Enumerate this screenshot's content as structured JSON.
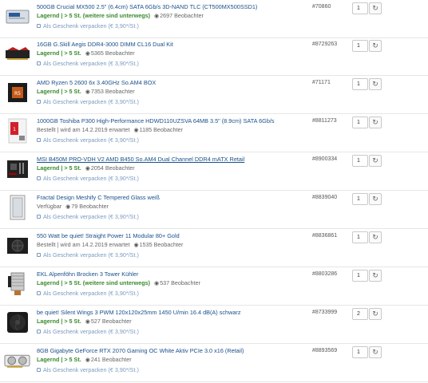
{
  "gift_label": "Als Geschenk verpacken (€ 3,90*/St.)",
  "colors": {
    "link": "#1a4f8a",
    "stock": "#3a8a2e",
    "gift": "#7a9ac0"
  },
  "items": [
    {
      "title": "500GB Crucial MX500 2.5\" (6.4cm) SATA 6Gb/s 3D-NAND TLC (CT500MX500SSD1)",
      "availability": "Lagernd | > 5 St. (weitere sind unterwegs)",
      "availability_type": "stock",
      "watchers": "2697 Beobachter",
      "article_no": "#70860",
      "quantity": "1",
      "thumb_icon": "ssd-icon"
    },
    {
      "title": "16GB G.Skill Aegis DDR4-3000 DIMM CL16 Dual Kit",
      "availability": "Lagernd | > 5 St.",
      "availability_type": "stock",
      "watchers": "5365 Beobachter",
      "article_no": "#8729263",
      "quantity": "1",
      "thumb_icon": "ram-icon"
    },
    {
      "title": "AMD Ryzen 5 2600 6x 3.40GHz So.AM4 BOX",
      "availability": "Lagernd | > 5 St.",
      "availability_type": "stock",
      "watchers": "7353 Beobachter",
      "article_no": "#71171",
      "quantity": "1",
      "thumb_icon": "cpu-box-icon"
    },
    {
      "title": "1000GB Toshiba P300 High-Performance HDWD110UZSVA 64MB 3.5\" (8.9cm) SATA 6Gb/s",
      "availability": "Bestellt | wird am 14.2.2019 erwartet",
      "availability_type": "order",
      "watchers": "1185 Beobachter",
      "article_no": "#8811273",
      "quantity": "1",
      "thumb_icon": "hdd-box-icon"
    },
    {
      "title": "MSI B450M PRO-VDH V2 AMD B450 So.AM4 Dual Channel DDR4 mATX Retail",
      "availability": "Lagernd | > 5 St.",
      "availability_type": "stock",
      "watchers": "2054 Beobachter",
      "article_no": "#8900334",
      "quantity": "1",
      "thumb_icon": "motherboard-icon"
    },
    {
      "title": "Fractal Design Meshify C Tempered Glass weiß",
      "availability": "Verfügbar",
      "availability_type": "order",
      "watchers": "79 Beobachter",
      "article_no": "#8839040",
      "quantity": "1",
      "thumb_icon": "case-icon"
    },
    {
      "title": "550 Watt be quiet! Straight Power 11 Modular 80+ Gold",
      "availability": "Bestellt | wird am 14.2.2019 erwartet",
      "availability_type": "order",
      "watchers": "1535 Beobachter",
      "article_no": "#8836861",
      "quantity": "1",
      "thumb_icon": "psu-icon"
    },
    {
      "title": "EKL Alpenföhn Brocken 3 Tower Kühler",
      "availability": "Lagernd | > 5 St. (weitere sind unterwegs)",
      "availability_type": "stock",
      "watchers": "537 Beobachter",
      "article_no": "#8803286",
      "quantity": "1",
      "thumb_icon": "cooler-icon"
    },
    {
      "title": "be quiet! Silent Wings 3 PWM 120x120x25mm 1450 U/min 16.4 dB(A) schwarz",
      "availability": "Lagernd | > 5 St.",
      "availability_type": "stock",
      "watchers": "527 Beobachter",
      "article_no": "#8733999",
      "quantity": "2",
      "thumb_icon": "fan-icon"
    },
    {
      "title": "8GB Gigabyte GeForce RTX 2070 Gaming OC White Aktiv PCIe 3.0 x16 (Retail)",
      "availability": "Lagernd | > 5 St.",
      "availability_type": "stock",
      "watchers": "241 Beobachter",
      "article_no": "#8893569",
      "quantity": "1",
      "thumb_icon": "gpu-icon"
    }
  ]
}
